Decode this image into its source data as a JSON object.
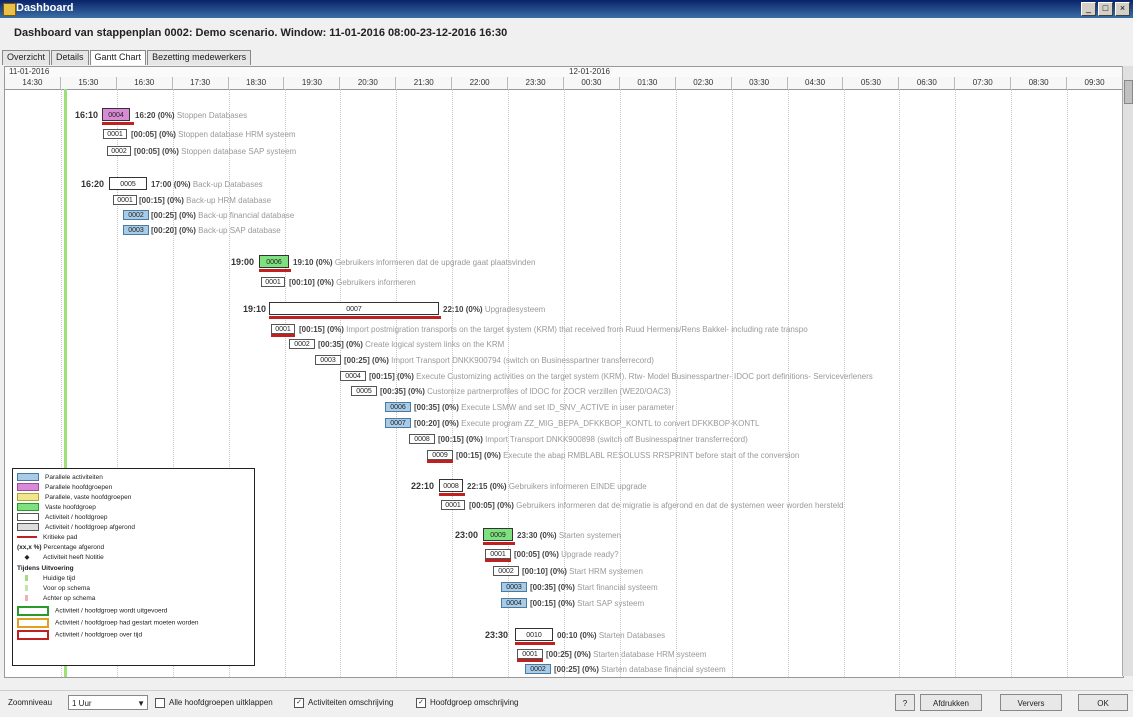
{
  "window": {
    "title": "Dashboard"
  },
  "heading": "Dashboard van stappenplan 0002: Demo scenario.  Window: 11-01-2016 08:00-23-12-2016 16:30",
  "tabs": [
    "Overzicht",
    "Details",
    "Gantt Chart",
    "Bezetting medewerkers"
  ],
  "dates": [
    "11-01-2016",
    "12-01-2016"
  ],
  "hours": [
    "14:30",
    "15:30",
    "16:30",
    "17:30",
    "18:30",
    "19:30",
    "20:30",
    "21:30",
    "22:00",
    "23:30",
    "00:30",
    "01:30",
    "02:30",
    "03:30",
    "04:30",
    "05:30",
    "06:30",
    "07:30",
    "08:30",
    "09:30"
  ],
  "groups": {
    "g1": {
      "start": "16:10",
      "id": "0004",
      "end": "16:20",
      "pct": "(0%)",
      "name": "Stoppen Databases"
    },
    "g2": {
      "start": "16:20",
      "id": "0005",
      "end": "17:00",
      "pct": "(0%)",
      "name": "Back-up Databases"
    },
    "g3": {
      "start": "19:00",
      "id": "0006",
      "end": "19:10",
      "pct": "(0%)",
      "name": "Gebruikers informeren dat de upgrade gaat plaatsvinden"
    },
    "g4": {
      "start": "19:10",
      "id": "0007",
      "end": "22:10",
      "pct": "(0%)",
      "name": "Upgradesysteem"
    },
    "g5": {
      "start": "22:10",
      "id": "0008",
      "end": "22:15",
      "pct": "(0%)",
      "name": "Gebruikers informeren EINDE upgrade"
    },
    "g6": {
      "start": "23:00",
      "id": "0009",
      "end": "23:30",
      "pct": "(0%)",
      "name": "Starten systemen"
    },
    "g7": {
      "start": "23:30",
      "id": "0010",
      "end": "00:10",
      "pct": "(0%)",
      "name": "Starten Databases"
    }
  },
  "activities": {
    "a1": {
      "id": "0001",
      "dur": "[00:05]",
      "pct": "(0%)",
      "name": "Stoppen database HRM systeem"
    },
    "a2": {
      "id": "0002",
      "dur": "[00:05]",
      "pct": "(0%)",
      "name": "Stoppen database SAP systeem"
    },
    "a3": {
      "id": "0001",
      "dur": "[00:15]",
      "pct": "(0%)",
      "name": "Back-up HRM database"
    },
    "a4": {
      "id": "0002",
      "dur": "[00:25]",
      "pct": "(0%)",
      "name": "Back-up financial database"
    },
    "a5": {
      "id": "0003",
      "dur": "[00:20]",
      "pct": "(0%)",
      "name": "Back-up SAP database"
    },
    "a6": {
      "id": "0001",
      "dur": "[00:10]",
      "pct": "(0%)",
      "name": "Gebruikers informeren"
    },
    "a7": {
      "id": "0001",
      "dur": "[00:15]",
      "pct": "(0%)",
      "name": "Import postmigration transports on the target system (KRM) that received from Ruud Hermens/Rens Bakkel- including rate transpo"
    },
    "a8": {
      "id": "0002",
      "dur": "[00:35]",
      "pct": "(0%)",
      "name": "Create logical system links on the KRM"
    },
    "a9": {
      "id": "0003",
      "dur": "[00:25]",
      "pct": "(0%)",
      "name": "Import Transport DNKK900794 (switch on Businesspartner transferrecord)"
    },
    "a10": {
      "id": "0004",
      "dur": "[00:15]",
      "pct": "(0%)",
      "name": "Execute Customizing activities on the target system (KRM). Rtw- Model Businesspartner- IDOC port definitions- Serviceverleners"
    },
    "a11": {
      "id": "0005",
      "dur": "[00:35]",
      "pct": "(0%)",
      "name": "Customize partnerprofiles of IDOC for ZOCR verzillen (WE20/OAC3)"
    },
    "a12": {
      "id": "0006",
      "dur": "[00:35]",
      "pct": "(0%)",
      "name": "Execute LSMW and set ID_SNV_ACTIVE in user parameter"
    },
    "a13": {
      "id": "0007",
      "dur": "[00:20]",
      "pct": "(0%)",
      "name": "Execute program ZZ_MIG_BEPA_DFKKBOP_KONTL to convert DFKKBOP-KONTL"
    },
    "a14": {
      "id": "0008",
      "dur": "[00:15]",
      "pct": "(0%)",
      "name": "Import Transport DNKK900898 (switch off Businesspartner transferrecord)"
    },
    "a15": {
      "id": "0009",
      "dur": "[00:15]",
      "pct": "(0%)",
      "name": "Execute the abap RMBLABL RESOLUSS RRSPRINT before start of the conversion"
    },
    "a16": {
      "id": "0001",
      "dur": "[00:05]",
      "pct": "(0%)",
      "name": "Gebruikers informeren dat de migratie is afgerond en dat de systemen weer worden hersteld"
    },
    "a17": {
      "id": "0001",
      "dur": "[00:05]",
      "pct": "(0%)",
      "name": "Upgrade ready?"
    },
    "a18": {
      "id": "0002",
      "dur": "[00:10]",
      "pct": "(0%)",
      "name": "Start HRM systemen"
    },
    "a19": {
      "id": "0003",
      "dur": "[00:35]",
      "pct": "(0%)",
      "name": "Start financial systeem"
    },
    "a20": {
      "id": "0004",
      "dur": "[00:15]",
      "pct": "(0%)",
      "name": "Start SAP systeem"
    },
    "a21": {
      "id": "0001",
      "dur": "[00:25]",
      "pct": "(0%)",
      "name": "Starten database HRM systeem"
    },
    "a22": {
      "id": "0002",
      "dur": "[00:25]",
      "pct": "(0%)",
      "name": "Starten database financial systeem"
    }
  },
  "legend": {
    "items": [
      "Parallele activiteiten",
      "Parallele hoofdgroepen",
      "Parallele, vaste hoofdgroepen",
      "Vaste hoofdgroep",
      "Activiteit / hoofdgroep",
      "Activiteit / hoofdgroep afgerond",
      "Kritieke pad",
      "Percentage afgerond",
      "Activiteit heeft Notitie"
    ],
    "pct_sample": "(xx,x %)",
    "section": "Tijdens Uitvoering",
    "exec_items": [
      "Huidige tijd",
      "Voor op schema",
      "Achter op schema",
      "Activiteit / hoofdgroep wordt uitgevoerd",
      "Activiteit / hoofdgroep had gestart moeten worden",
      "Activiteit / hoofdgroep over tijd"
    ],
    "colors": {
      "parallel": "#a8cce8",
      "pink": "#d98ad6",
      "yellow": "#f0e68c",
      "green": "#7ee07e",
      "critical": "#c02020"
    }
  },
  "bottom": {
    "zoom_label": "Zoomniveau",
    "zoom_value": "1 Uur",
    "cb1": "Alle hoofdgroepen uitklappen",
    "cb2": "Activiteiten omschrijving",
    "cb3": "Hoofdgroep omschrijving",
    "help": "?",
    "print": "Afdrukken",
    "refresh": "Ververs",
    "ok": "OK"
  }
}
